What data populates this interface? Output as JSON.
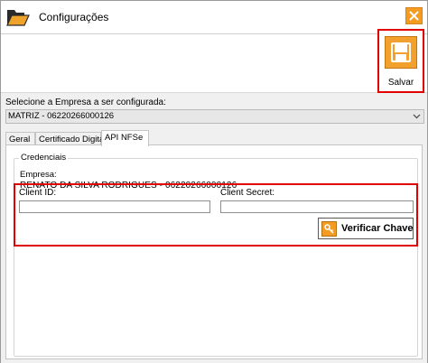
{
  "window": {
    "title": "Configurações",
    "icon": "folder-open-icon",
    "close_icon": "close-icon",
    "accent": "#f39c21"
  },
  "toolbar": {
    "save_label": "Salvar",
    "save_icon": "floppy-disk-icon"
  },
  "company": {
    "label": "Selecione a Empresa a ser configurada:",
    "selected": "MATRIZ - 06220266000126"
  },
  "tabs": [
    {
      "label": "Geral",
      "active": false
    },
    {
      "label": "Certificado Digital",
      "active": false
    },
    {
      "label": "API NFSe",
      "active": true
    }
  ],
  "credentials": {
    "group_title": "Credenciais",
    "empresa_label": "Empresa:",
    "empresa_value": "RENATO DA SILVA RODRIGUES - 06220266000126",
    "client_id_label": "Client ID:",
    "client_id_value": "",
    "client_secret_label": "Client Secret:",
    "client_secret_value": "",
    "verify_label": "Verificar Chave",
    "verify_icon": "key-icon"
  },
  "highlight_color": "#e00000"
}
